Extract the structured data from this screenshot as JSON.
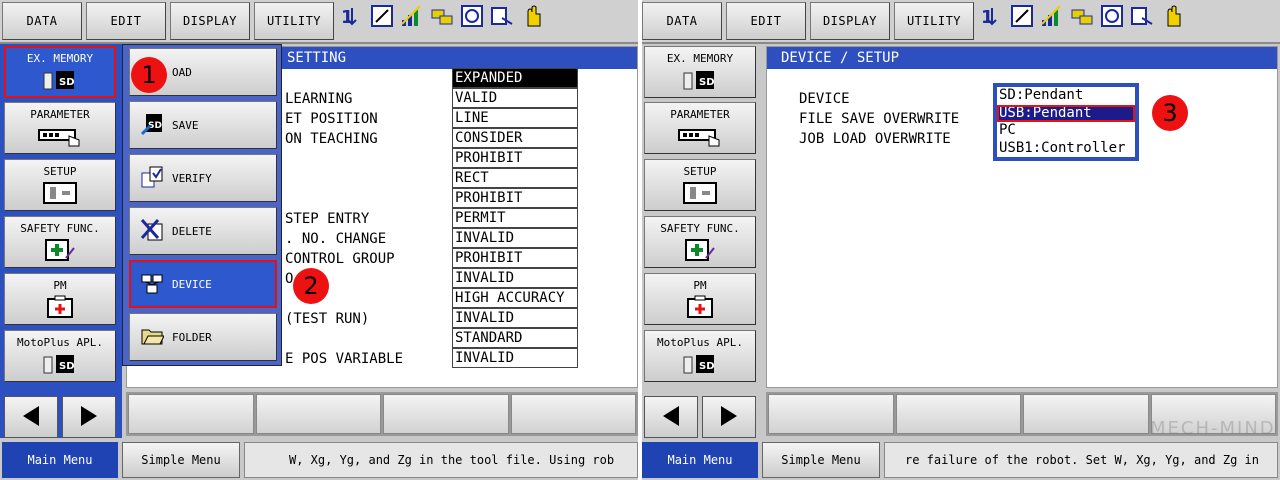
{
  "menubar": {
    "buttons": [
      "DATA",
      "EDIT",
      "DISPLAY",
      "UTILITY"
    ],
    "toolbar_icons": [
      "sort-icon",
      "edit-icon",
      "signal-icon",
      "cars-icon",
      "settings-disk-icon",
      "export-icon",
      "hand-icon"
    ]
  },
  "sidebar": {
    "items": [
      {
        "label": "EX. MEMORY",
        "icon": "sd-card-icon"
      },
      {
        "label": "PARAMETER",
        "icon": "parameter-icon"
      },
      {
        "label": "SETUP",
        "icon": "setup-icon"
      },
      {
        "label": "SAFETY FUNC.",
        "icon": "safety-icon"
      },
      {
        "label": "PM",
        "icon": "pm-icon"
      },
      {
        "label": "MotoPlus APL.",
        "icon": "sd-card-icon"
      }
    ]
  },
  "left_screen": {
    "title": "SETTING",
    "labels": [
      "LEARNING",
      "ET POSITION",
      "ON TEACHING",
      "",
      "",
      "",
      "STEP ENTRY",
      ". NO. CHANGE",
      "CONTROL GROUP",
      "O",
      "",
      "(TEST RUN)",
      "",
      "E POS VARIABLE"
    ],
    "values": [
      "EXPANDED",
      "VALID",
      "LINE",
      "CONSIDER",
      "PROHIBIT",
      "RECT",
      "PROHIBIT",
      "PERMIT",
      "INVALID",
      "PROHIBIT",
      "INVALID",
      "HIGH ACCURACY",
      "INVALID",
      "STANDARD",
      "INVALID"
    ]
  },
  "submenu": {
    "items": [
      {
        "label": "LOAD",
        "visible": "OAD",
        "icon": "load-icon"
      },
      {
        "label": "SAVE",
        "icon": "save-icon"
      },
      {
        "label": "VERIFY",
        "icon": "verify-icon"
      },
      {
        "label": "DELETE",
        "icon": "delete-icon"
      },
      {
        "label": "DEVICE",
        "icon": "device-icon"
      },
      {
        "label": "FOLDER",
        "icon": "folder-icon"
      }
    ]
  },
  "right_screen": {
    "title": "DEVICE / SETUP",
    "labels": [
      "DEVICE",
      "FILE SAVE OVERWRITE",
      "JOB LOAD OVERWRITE"
    ],
    "dropdown": {
      "options": [
        "SD:Pendant",
        "USB:Pendant",
        "PC",
        "USB1:Controller"
      ],
      "selected_index": 1
    }
  },
  "status": {
    "main_menu": "Main Menu",
    "simple_menu": "Simple Menu",
    "left_message": "W, Xg, Yg, and Zg in the tool file.   Using rob",
    "right_message": "re failure of the robot. Set W, Xg, Yg, and Zg in"
  },
  "badges": {
    "one": "1",
    "two": "2",
    "three": "3"
  },
  "watermark": "MECH-MIND",
  "colors": {
    "accent_blue": "#2d50c0",
    "highlight_red": "#e81010",
    "selected": "#1b1b8a"
  }
}
